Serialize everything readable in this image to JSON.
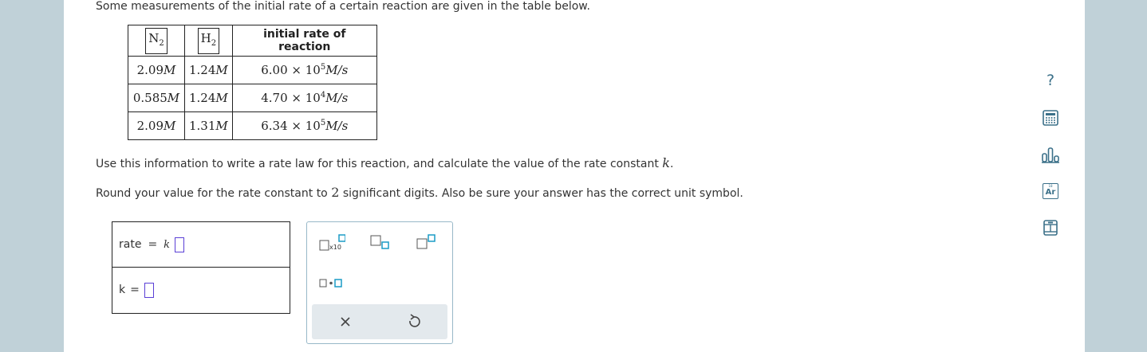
{
  "question": {
    "intro": "Some measurements of the initial rate of a certain reaction are given in the table below.",
    "instruction_1": "Use this information to write a rate law for this reaction, and calculate the value of the rate constant",
    "instruction_1_var": "k",
    "instruction_1_end": ".",
    "instruction_2_a": "Round your value for the rate constant to",
    "instruction_2_num": "2",
    "instruction_2_b": "significant digits. Also be sure your answer has the correct unit symbol."
  },
  "table": {
    "col1_species": "N",
    "col1_sub": "2",
    "col2_species": "H",
    "col2_sub": "2",
    "col3_header": "initial rate of reaction",
    "rows": [
      {
        "n2": "2.09",
        "h2": "1.24",
        "rate_mant": "6.00 × 10",
        "rate_exp": "5",
        "unit": "M/s"
      },
      {
        "n2": "0.585",
        "h2": "1.24",
        "rate_mant": "4.70 × 10",
        "rate_exp": "4",
        "unit": "M/s"
      },
      {
        "n2": "2.09",
        "h2": "1.31",
        "rate_mant": "6.34 × 10",
        "rate_exp": "5",
        "unit": "M/s"
      }
    ],
    "conc_unit": "M"
  },
  "answer": {
    "rate_label": "rate",
    "equals": "=",
    "rate_k": "k",
    "k_label": "k",
    "k_equals": "="
  },
  "palette": {
    "x10_label": "x10",
    "clear_icon": "times-icon",
    "undo_icon": "undo-icon"
  },
  "sidebar": {
    "help": "?",
    "periodic_label": "Ar",
    "periodic_num": "18"
  },
  "colors": {
    "accent": "#3b7089",
    "slot_border": "#5a3fd6",
    "palette_slot": "#1a9bc6"
  }
}
